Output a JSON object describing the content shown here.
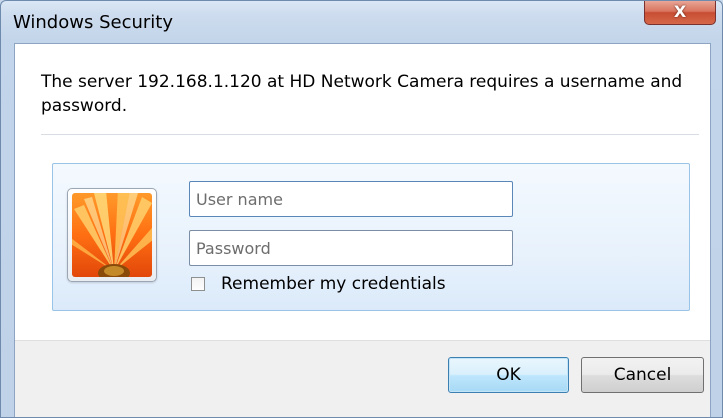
{
  "window": {
    "title": "Windows Security",
    "close_symbol": "X"
  },
  "dialog": {
    "message": "The server 192.168.1.120 at HD Network Camera requires a username and password.",
    "username": {
      "value": "",
      "placeholder": "User name"
    },
    "password": {
      "value": "",
      "placeholder": "Password"
    },
    "remember_label": "Remember my credentials",
    "remember_checked": false,
    "avatar_icon": "flower-user-tile-icon"
  },
  "buttons": {
    "ok": "OK",
    "cancel": "Cancel"
  },
  "colors": {
    "title_gradient_top": "#dbe7f5",
    "close_button_red": "#c74d33",
    "tile_border": "#99c3e7",
    "tile_background": "#e8f2fc",
    "footer_background": "#f0f0f0",
    "ok_border": "#3c7fb1"
  }
}
